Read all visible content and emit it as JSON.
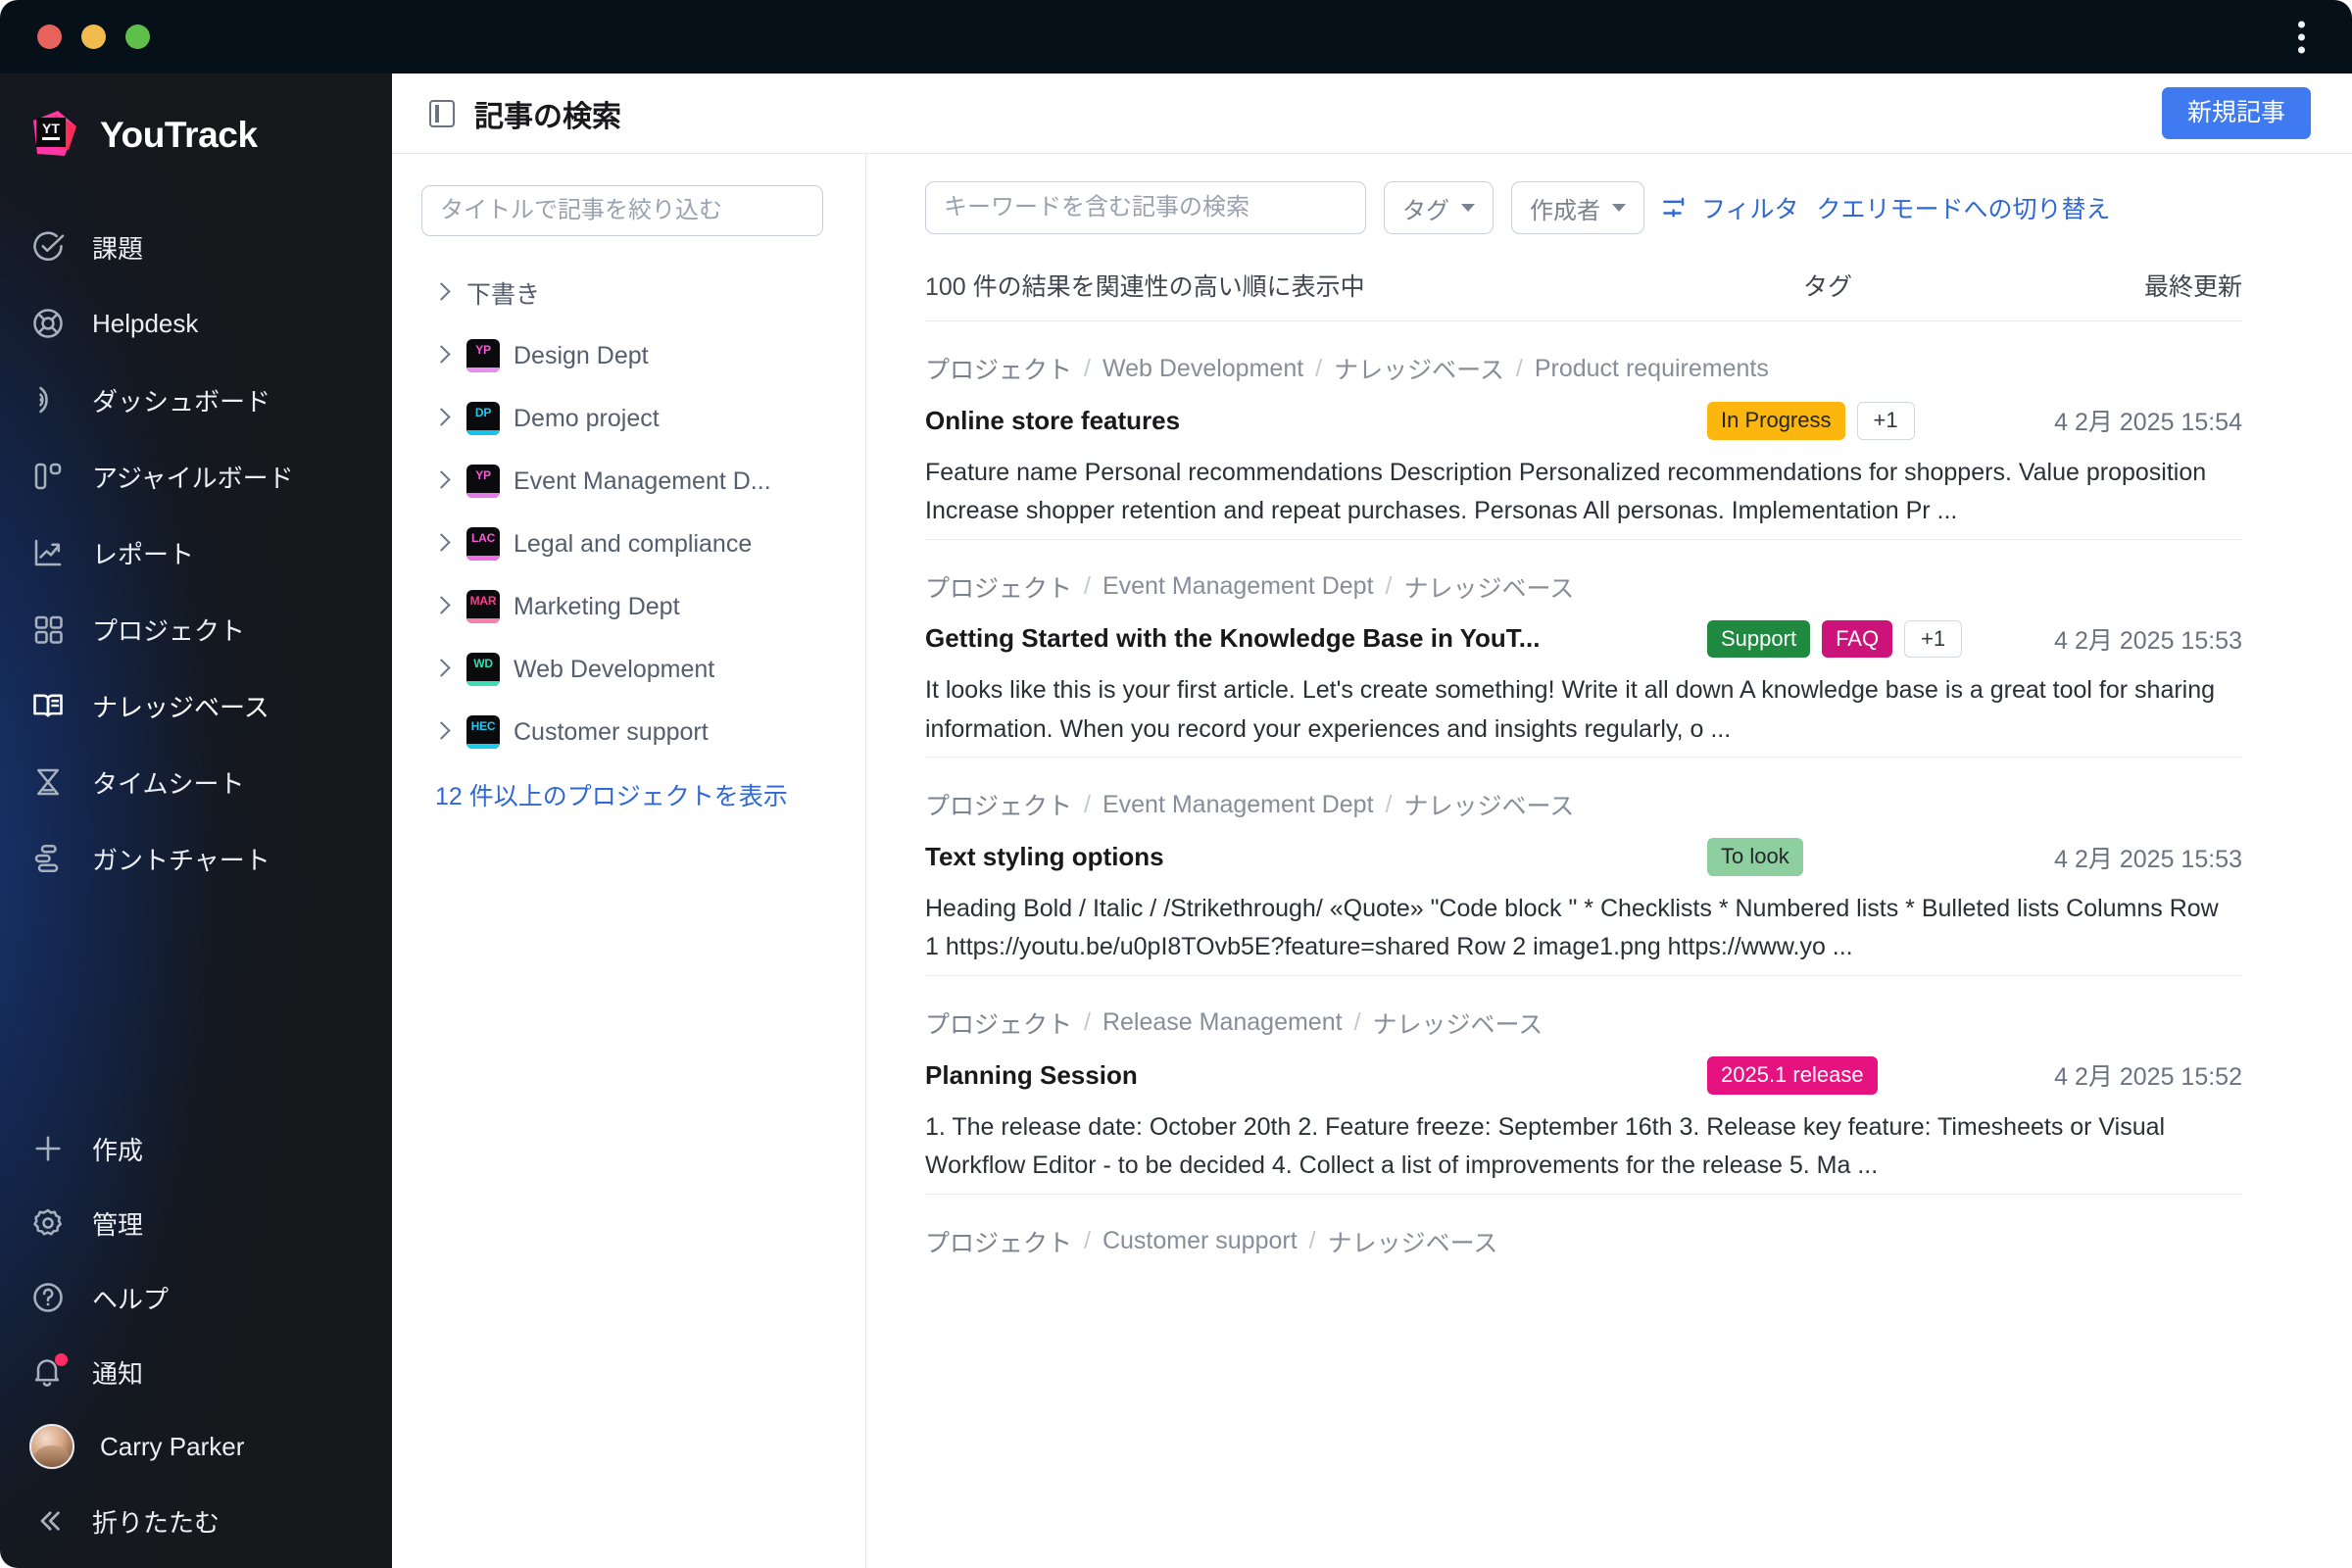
{
  "window": {
    "traffic_lights": [
      "close",
      "minimize",
      "maximize"
    ],
    "menu_icon": "kebab-menu-icon"
  },
  "sidebar": {
    "brand": "YouTrack",
    "items": [
      {
        "label": "課題",
        "icon": "check-circle-icon",
        "active": false
      },
      {
        "label": "Helpdesk",
        "icon": "lifebuoy-icon",
        "active": false
      },
      {
        "label": "ダッシュボード",
        "icon": "dashboard-icon",
        "active": false
      },
      {
        "label": "アジャイルボード",
        "icon": "agile-board-icon",
        "active": false
      },
      {
        "label": "レポート",
        "icon": "report-chart-icon",
        "active": false
      },
      {
        "label": "プロジェクト",
        "icon": "grid-squares-icon",
        "active": false
      },
      {
        "label": "ナレッジベース",
        "icon": "open-book-icon",
        "active": true
      },
      {
        "label": "タイムシート",
        "icon": "hourglass-icon",
        "active": false
      },
      {
        "label": "ガントチャート",
        "icon": "gantt-chart-icon",
        "active": false
      }
    ],
    "bottom_items": [
      {
        "label": "作成",
        "icon": "plus-icon"
      },
      {
        "label": "管理",
        "icon": "gear-icon"
      },
      {
        "label": "ヘルプ",
        "icon": "question-circle-icon"
      },
      {
        "label": "通知",
        "icon": "bell-icon",
        "badge": true
      }
    ],
    "user": {
      "name": "Carry Parker",
      "avatar": "user-avatar"
    },
    "collapse": {
      "label": "折りたたむ",
      "icon": "chevron-double-left-icon"
    }
  },
  "header": {
    "panel_toggle_icon": "panel-toggle-icon",
    "title": "記事の検索",
    "new_article_label": "新規記事"
  },
  "tree": {
    "filter_placeholder": "タイトルで記事を絞り込む",
    "filter_value": "",
    "items": [
      {
        "label": "下書き",
        "has_icon": false,
        "key": "",
        "key_color": "#ffffff",
        "bar_color": ""
      },
      {
        "label": "Design Dept",
        "has_icon": true,
        "key": "YP",
        "key_color": "#ff57d9",
        "bar_color": "#e98ff0"
      },
      {
        "label": "Demo project",
        "has_icon": true,
        "key": "DP",
        "key_color": "#21c7f0",
        "bar_color": "#18c4ee"
      },
      {
        "label": "Event Management D...",
        "has_icon": true,
        "key": "YP",
        "key_color": "#ff57d9",
        "bar_color": "#e77ae8"
      },
      {
        "label": "Legal and compliance",
        "has_icon": true,
        "key": "LAC",
        "key_color": "#ff57d9",
        "bar_color": "#ef6ee8"
      },
      {
        "label": "Marketing Dept",
        "has_icon": true,
        "key": "MAR",
        "key_color": "#ff3d8b",
        "bar_color": "#f87fae"
      },
      {
        "label": "Web Development",
        "has_icon": true,
        "key": "WD",
        "key_color": "#2ce0b0",
        "bar_color": "#3fddb7"
      },
      {
        "label": "Customer support",
        "has_icon": true,
        "key": "HEC",
        "key_color": "#21c7f0",
        "bar_color": "#1ec9ef"
      }
    ],
    "more_label": "12 件以上のプロジェクトを表示"
  },
  "search": {
    "keyword_placeholder": "キーワードを含む記事の検索",
    "keyword_value": "",
    "tag_select": "タグ",
    "author_select": "作成者",
    "filter_label": "フィルタ",
    "query_mode_label": "クエリモードへの切り替え"
  },
  "results_meta": {
    "count_text": "100 件の結果を関連性の高い順に表示中",
    "col_tags": "タグ",
    "col_updated": "最終更新"
  },
  "results": [
    {
      "breadcrumb": [
        "プロジェクト",
        "Web Development",
        "ナレッジベース",
        "Product requirements"
      ],
      "title": "Online store features",
      "tags": [
        {
          "label": "In Progress",
          "bg": "#fdb60d",
          "fg": "#23262b"
        },
        {
          "label": "+1",
          "bg": "#ffffff",
          "fg": "#33373e",
          "more": true
        }
      ],
      "updated": "4 2月 2025 15:54",
      "snippet": "Feature name Personal recommendations Description Personalized recommendations for shoppers. Value proposition Increase shopper retention and repeat purchases. Personas All personas. Implementation Pr ..."
    },
    {
      "breadcrumb": [
        "プロジェクト",
        "Event Management Dept",
        "ナレッジベース"
      ],
      "title": "Getting Started with the Knowledge Base in YouT...",
      "tags": [
        {
          "label": "Support",
          "bg": "#1f8a3f",
          "fg": "#ffffff"
        },
        {
          "label": "FAQ",
          "bg": "#cc1379",
          "fg": "#ffffff"
        },
        {
          "label": "+1",
          "bg": "#ffffff",
          "fg": "#33373e",
          "more": true
        }
      ],
      "updated": "4 2月 2025 15:53",
      "snippet": "It looks like this is your first article. Let's create something! Write it all down A knowledge base is a great tool for sharing information. When you record your experiences and insights regularly, o ..."
    },
    {
      "breadcrumb": [
        "プロジェクト",
        "Event Management Dept",
        "ナレッジベース"
      ],
      "title": "Text styling options",
      "tags": [
        {
          "label": "To look",
          "bg": "#8dcf9e",
          "fg": "#23262b"
        }
      ],
      "updated": "4 2月 2025 15:53",
      "snippet": "Heading Bold / Italic / /Strikethrough/ «Quote» \"Code block \" * Checklists * Numbered lists * Bulleted lists Columns Row 1 https://youtu.be/u0pI8TOvb5E?feature=shared Row 2 image1.png https://www.yo ..."
    },
    {
      "breadcrumb": [
        "プロジェクト",
        "Release Management",
        "ナレッジベース"
      ],
      "title": "Planning Session",
      "tags": [
        {
          "label": "2025.1 release",
          "bg": "#e6127f",
          "fg": "#ffffff"
        }
      ],
      "updated": "4 2月 2025 15:52",
      "snippet": "1. The release date: October 20th 2. Feature freeze: September 16th 3. Release key feature: Timesheets or Visual Workflow Editor - to be decided 4. Collect a list of improvements for the release 5. Ma ..."
    },
    {
      "breadcrumb": [
        "プロジェクト",
        "Customer support",
        "ナレッジベース"
      ],
      "title": "",
      "tags": [],
      "updated": "",
      "snippet": ""
    }
  ]
}
